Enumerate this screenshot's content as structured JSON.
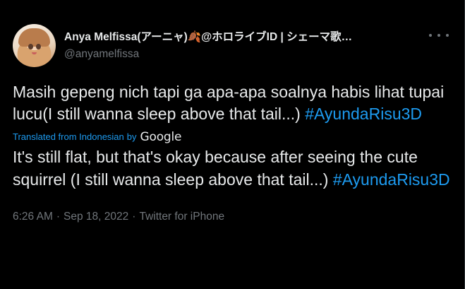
{
  "author": {
    "display_name": "Anya Melfissa(アーニャ)🍂@ホロライブID | シェーマ歌…",
    "handle": "@anyamelfissa"
  },
  "tweet": {
    "original_text": "Masih gepeng nich tapi ga apa-apa soalnya habis lihat tupai lucu(I still wanna sleep above that tail...) ",
    "original_hashtag": "#AyundaRisu3D",
    "translated_label": "Translated from Indonesian",
    "translated_by": "by",
    "translator": "Google",
    "translation_text": "It's still flat, but that's okay because after seeing the cute squirrel (I still wanna sleep above that tail...) ",
    "translation_hashtag": "#AyundaRisu3D"
  },
  "meta": {
    "time": "6:26 AM",
    "separator": "·",
    "date": "Sep 18, 2022",
    "source": "Twitter for iPhone"
  },
  "icons": {
    "more": "more-options-icon",
    "avatar": "avatar-image"
  },
  "colors": {
    "background": "#000000",
    "text": "#e7e9ea",
    "secondary": "#71767b",
    "accent": "#1d9bf0"
  }
}
